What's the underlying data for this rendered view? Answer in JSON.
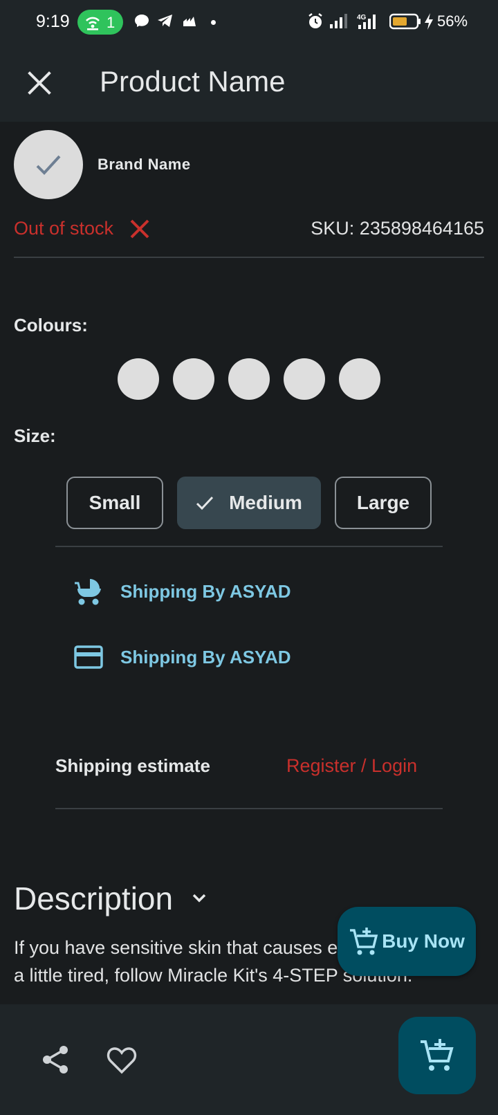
{
  "status_bar": {
    "time": "9:19",
    "hotspot_count": "1",
    "battery_percent": "56%",
    "network_label": "4G"
  },
  "app_bar": {
    "title": "Product Name",
    "close_icon": "close-icon"
  },
  "brand": {
    "name": "Brand Name",
    "avatar_icon": "check-icon"
  },
  "stock": {
    "status": "Out of stock",
    "status_color": "#c9302c",
    "sku_label": "SKU: 235898464165"
  },
  "colours": {
    "label": "Colours:",
    "swatches": [
      "#dedede",
      "#dedede",
      "#dedede",
      "#dedede",
      "#dedede"
    ]
  },
  "size": {
    "label": "Size:",
    "options": [
      {
        "label": "Small",
        "selected": false
      },
      {
        "label": "Medium",
        "selected": true
      },
      {
        "label": "Large",
        "selected": false
      }
    ]
  },
  "shipping": {
    "rows": [
      {
        "icon": "stroller-icon",
        "label": "Shipping By ASYAD"
      },
      {
        "icon": "credit-card-icon",
        "label": "Shipping By ASYAD"
      }
    ],
    "estimate_label": "Shipping estimate",
    "login_link": "Register / Login"
  },
  "description": {
    "title": "Description",
    "text": "If you have sensitive skin that causes even if you're a little tired, follow Miracle Kit's 4-STEP solution."
  },
  "buy_now": {
    "label": "Buy Now",
    "color": "#004d60"
  },
  "bottom_bar": {
    "share_icon": "share-icon",
    "favorite_icon": "heart-icon",
    "cart_icon": "add-cart-icon"
  },
  "colors": {
    "background": "#191c1e",
    "surface": "#1f2528",
    "accent_link": "#7ec8e3",
    "error": "#c9302c"
  }
}
